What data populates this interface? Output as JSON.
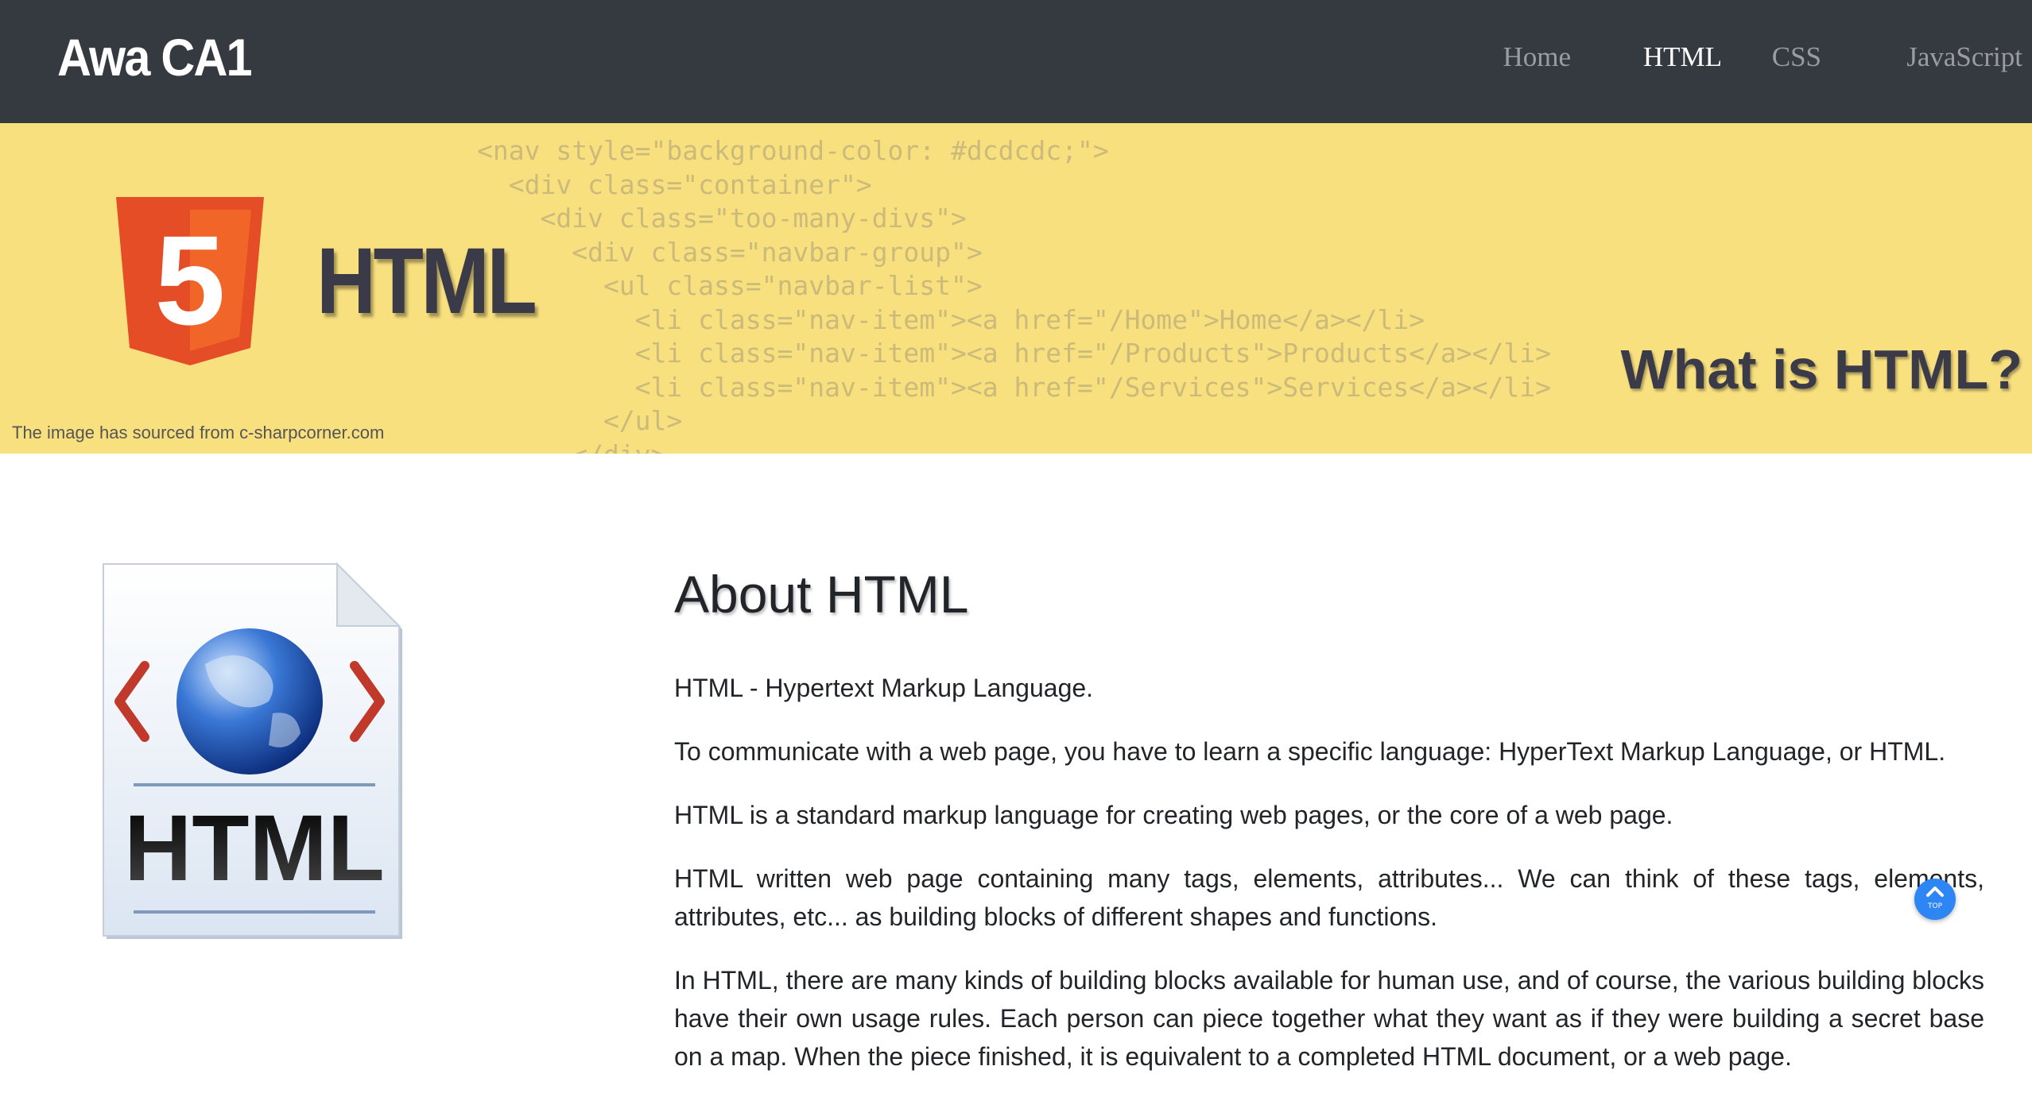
{
  "navbar": {
    "brand": "Awa CA1",
    "links": [
      {
        "label": "Home",
        "active": false
      },
      {
        "label": "HTML",
        "active": true
      },
      {
        "label": "CSS",
        "active": false
      },
      {
        "label": "JavaScript",
        "active": false
      }
    ]
  },
  "hero": {
    "code_lines": [
      "<nav style=\"background-color: #dcdcdc;\">",
      "  <div class=\"container\">",
      "    <div class=\"too-many-divs\">",
      "      <div class=\"navbar-group\">",
      "        <ul class=\"navbar-list\">",
      "          <li class=\"nav-item\"><a href=\"/Home\">Home</a></li>",
      "          <li class=\"nav-item\"><a href=\"/Products\">Products</a></li>",
      "          <li class=\"nav-item\"><a href=\"/Services\">Services</a></li>",
      "        </ul>",
      "      </div>"
    ],
    "logo_digit": "5",
    "logo_word": "HTML",
    "question": "What is HTML?",
    "credit": "The image has sourced from c-sharpcorner.com"
  },
  "doc_icon": {
    "label": "HTML"
  },
  "about": {
    "title": "About HTML",
    "paragraphs": [
      "HTML - Hypertext Markup Language.",
      "To communicate with a web page, you have to learn a specific language: HyperText Markup Language, or HTML.",
      "HTML is a standard markup language for creating web pages, or the core of a web page.",
      "HTML written web page containing many tags, elements, attributes... We can think of these tags, elements, attributes, etc... as building blocks of different shapes and functions.",
      "In HTML, there are many kinds of building blocks available for human use, and of course, the various building blocks have their own usage rules. Each person can piece together what they want as if they were building a secret base on a map. When the piece finished, it is equivalent to a completed HTML document, or a web page."
    ]
  },
  "scroll_top": {
    "label": "TOP",
    "icon": "chevron-up-icon"
  },
  "colors": {
    "navbar_bg": "#343a40",
    "nav_link": "#9a9da0",
    "nav_active": "#ffffff",
    "hero_bg": "#f8e07f",
    "html5_orange": "#e44d26",
    "top_button": "#2e86f5"
  }
}
